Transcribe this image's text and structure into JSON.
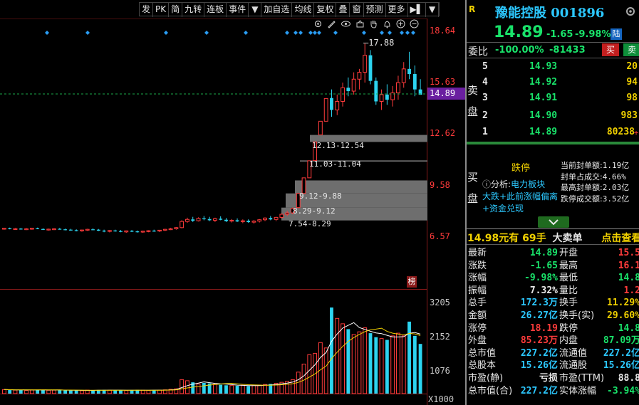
{
  "toolbar": {
    "buttons": [
      "发",
      "PK",
      "简",
      "九转",
      "连板",
      "事件",
      "▼",
      "加自选",
      "均线",
      "复权",
      "叠",
      "窗",
      "预测",
      "更多",
      "▶▌",
      "▼"
    ]
  },
  "chart": {
    "price_axis": [
      "18.64",
      "15.63",
      "14.89",
      "12.62",
      "9.58",
      "6.57"
    ],
    "current_price_tag": "14.89",
    "high_marker": "17.88",
    "gap_labels": [
      "12.13-12.54",
      "11.03-11.04",
      "9.12-9.88",
      "8.29-9.12",
      "7.54-8.29"
    ],
    "volume_axis": [
      "3205",
      "2152",
      "1076",
      "X1000"
    ],
    "rank_badge": "榜",
    "tool_icons": [
      "gear-icon",
      "pen-icon",
      "eye-icon",
      "basket-icon",
      "hand-icon",
      "bell-icon",
      "plus-icon",
      "minus-icon"
    ]
  },
  "chart_data": {
    "type": "candlestick",
    "ylim": [
      5.5,
      19.5
    ],
    "candles": [
      [
        7.05,
        7.1,
        7.0,
        7.08
      ],
      [
        7.08,
        7.12,
        7.02,
        7.05
      ],
      [
        7.05,
        7.1,
        7.0,
        7.06
      ],
      [
        7.06,
        7.1,
        7.0,
        7.03
      ],
      [
        7.03,
        7.09,
        6.98,
        7.05
      ],
      [
        7.05,
        7.1,
        7.0,
        7.08
      ],
      [
        7.08,
        7.12,
        7.03,
        7.04
      ],
      [
        7.04,
        7.08,
        6.98,
        7.0
      ],
      [
        7.0,
        7.06,
        6.95,
        7.03
      ],
      [
        7.03,
        7.08,
        6.98,
        7.05
      ],
      [
        7.05,
        7.1,
        7.0,
        7.02
      ],
      [
        7.02,
        7.06,
        6.96,
        7.0
      ],
      [
        7.0,
        7.05,
        6.94,
        6.97
      ],
      [
        6.97,
        7.02,
        6.9,
        6.95
      ],
      [
        6.95,
        7.0,
        6.88,
        6.98
      ],
      [
        6.98,
        7.05,
        6.93,
        7.02
      ],
      [
        7.02,
        7.08,
        6.97,
        7.0
      ],
      [
        7.0,
        7.04,
        6.92,
        6.94
      ],
      [
        6.94,
        7.0,
        6.85,
        6.9
      ],
      [
        6.9,
        6.98,
        6.84,
        6.95
      ],
      [
        6.95,
        7.0,
        6.88,
        6.92
      ],
      [
        6.92,
        6.98,
        6.85,
        6.87
      ],
      [
        6.87,
        6.95,
        6.82,
        6.93
      ],
      [
        6.93,
        6.98,
        6.86,
        6.9
      ],
      [
        6.9,
        6.95,
        6.83,
        6.88
      ],
      [
        6.88,
        6.94,
        6.82,
        6.91
      ],
      [
        6.91,
        6.97,
        6.85,
        6.94
      ],
      [
        6.94,
        7.0,
        6.88,
        6.92
      ],
      [
        6.92,
        6.98,
        6.86,
        6.97
      ],
      [
        6.97,
        7.05,
        6.92,
        7.02
      ],
      [
        7.02,
        7.1,
        6.98,
        7.05
      ],
      [
        7.05,
        7.15,
        7.0,
        7.12
      ],
      [
        7.12,
        7.55,
        7.08,
        7.48
      ],
      [
        7.48,
        7.7,
        7.4,
        7.6
      ],
      [
        7.6,
        7.75,
        7.45,
        7.52
      ],
      [
        7.52,
        7.72,
        7.48,
        7.66
      ],
      [
        7.66,
        7.8,
        7.55,
        7.62
      ],
      [
        7.62,
        7.75,
        7.5,
        7.55
      ],
      [
        7.55,
        7.7,
        7.45,
        7.64
      ],
      [
        7.64,
        7.78,
        7.55,
        7.58
      ],
      [
        7.58,
        7.68,
        7.45,
        7.5
      ],
      [
        7.5,
        7.62,
        7.42,
        7.55
      ],
      [
        7.55,
        7.66,
        7.45,
        7.48
      ],
      [
        7.48,
        7.6,
        7.38,
        7.52
      ],
      [
        7.52,
        7.6,
        7.4,
        7.44
      ],
      [
        7.44,
        7.56,
        7.35,
        7.5
      ],
      [
        7.5,
        7.62,
        7.42,
        7.58
      ],
      [
        7.58,
        7.72,
        7.5,
        7.68
      ],
      [
        7.68,
        7.8,
        7.55,
        7.6
      ],
      [
        7.6,
        7.75,
        7.5,
        7.72
      ],
      [
        7.72,
        7.95,
        7.65,
        7.9
      ],
      [
        7.9,
        8.1,
        7.8,
        7.98
      ],
      [
        7.98,
        8.3,
        7.9,
        8.25
      ],
      [
        8.29,
        9.12,
        8.29,
        9.12
      ],
      [
        9.12,
        10.03,
        9.12,
        10.03
      ],
      [
        10.03,
        11.03,
        10.03,
        11.03
      ],
      [
        11.04,
        12.13,
        11.04,
        12.13
      ],
      [
        12.54,
        13.34,
        12.54,
        13.34
      ],
      [
        13.34,
        14.67,
        13.34,
        14.67
      ],
      [
        14.7,
        15.2,
        13.6,
        14.0
      ],
      [
        14.0,
        14.9,
        13.7,
        14.5
      ],
      [
        14.5,
        15.6,
        14.2,
        15.3
      ],
      [
        15.3,
        15.9,
        14.8,
        15.1
      ],
      [
        15.1,
        16.2,
        14.9,
        15.8
      ],
      [
        15.8,
        16.4,
        15.2,
        16.2
      ],
      [
        16.2,
        17.88,
        15.6,
        17.2
      ],
      [
        17.2,
        17.5,
        15.5,
        15.7
      ],
      [
        15.7,
        15.9,
        14.3,
        14.5
      ],
      [
        14.5,
        15.2,
        14.0,
        14.9
      ],
      [
        14.9,
        15.5,
        14.3,
        14.6
      ],
      [
        14.6,
        15.4,
        14.2,
        15.0
      ],
      [
        15.0,
        16.0,
        14.6,
        15.6
      ],
      [
        15.6,
        16.8,
        15.3,
        16.4
      ],
      [
        16.4,
        17.4,
        15.8,
        16.1
      ],
      [
        16.1,
        16.6,
        14.8,
        15.2
      ],
      [
        15.2,
        15.8,
        14.89,
        14.89
      ]
    ],
    "volume_x1000": [
      150,
      140,
      130,
      145,
      120,
      135,
      150,
      140,
      125,
      130,
      140,
      120,
      115,
      125,
      110,
      130,
      120,
      135,
      140,
      125,
      130,
      120,
      115,
      135,
      140,
      125,
      120,
      135,
      130,
      140,
      160,
      180,
      520,
      480,
      420,
      360,
      400,
      380,
      350,
      330,
      310,
      300,
      290,
      310,
      280,
      300,
      320,
      340,
      360,
      380,
      420,
      460,
      520,
      800,
      1100,
      1450,
      1500,
      1900,
      1700,
      3205,
      2800,
      2600,
      2400,
      2200,
      2300,
      2450,
      2250,
      2100,
      2050,
      2000,
      2150,
      2250,
      2150,
      2680,
      2150,
      1850
    ]
  },
  "stock": {
    "r_mark": "R",
    "name_code": "豫能控股 001896",
    "price": "14.89",
    "change": "-1.65",
    "change_pct": "-9.98%",
    "lu_badge": "陆",
    "webi_label": "委比",
    "webi_pct": "-100.00%",
    "webi_diff": "-81433",
    "buy_btn": "买",
    "sell_btn": "卖"
  },
  "sell_book": {
    "side_label": "卖盘",
    "levels": [
      {
        "n": "5",
        "price": "14.93",
        "vol": "20"
      },
      {
        "n": "4",
        "price": "14.92",
        "vol": "94"
      },
      {
        "n": "3",
        "price": "14.91",
        "vol": "98"
      },
      {
        "n": "2",
        "price": "14.90",
        "vol": "983"
      },
      {
        "n": "1",
        "price": "14.89",
        "vol": "80238",
        "extra": "+4"
      }
    ]
  },
  "buy_book": {
    "side_label": "买盘",
    "limit_down": "跌停",
    "analysis_prefix": "分析:",
    "analysis_topic": "电力板块",
    "analysis_line2": "大跌+此前涨幅偏离",
    "analysis_line3": "+资金兑现",
    "seal_stats": [
      {
        "label": "当前封单额:",
        "value": "1.19亿"
      },
      {
        "label": "封单占成交:",
        "value": "4.66%"
      },
      {
        "label": "最高封单额:",
        "value": "2.03亿"
      },
      {
        "label": "跌停成交额:",
        "value": "3.52亿"
      }
    ]
  },
  "trade_bar": {
    "price": "14.98元有",
    "lots": "69手",
    "big_sell": "大卖单",
    "click": "点击查看"
  },
  "stats": [
    {
      "l1": "最新",
      "v1": "14.89",
      "c1": "green",
      "l2": "开盘",
      "v2": "15.5",
      "c2": "red"
    },
    {
      "l1": "涨跌",
      "v1": "-1.65",
      "c1": "green",
      "l2": "最高",
      "v2": "16.1",
      "c2": "red"
    },
    {
      "l1": "涨幅",
      "v1": "-9.98%",
      "c1": "green",
      "l2": "最低",
      "v2": "14.8",
      "c2": "green"
    },
    {
      "l1": "振幅",
      "v1": "7.32%",
      "c1": "white",
      "l2": "量比",
      "v2": "1.2",
      "c2": "red"
    },
    {
      "l1": "总手",
      "v1": "172.3万",
      "c1": "cyan",
      "l2": "换手",
      "v2": "11.29%",
      "c2": "yellow"
    },
    {
      "l1": "金额",
      "v1": "26.27亿",
      "c1": "cyan",
      "l2": "换手(实)",
      "v2": "29.60%",
      "c2": "yellow"
    },
    {
      "l1": "涨停",
      "v1": "18.19",
      "c1": "red",
      "l2": "跌停",
      "v2": "14.8",
      "c2": "green"
    },
    {
      "l1": "外盘",
      "v1": "85.23万",
      "c1": "red",
      "l2": "内盘",
      "v2": "87.09万",
      "c2": "green"
    },
    {
      "l1": "总市值",
      "v1": "227.2亿",
      "c1": "cyan",
      "l2": "流通值",
      "v2": "227.2亿",
      "c2": "cyan"
    },
    {
      "l1": "总股本",
      "v1": "15.26亿",
      "c1": "cyan",
      "l2": "流通股",
      "v2": "15.26亿",
      "c2": "cyan"
    },
    {
      "l1": "市盈(静)",
      "v1": "亏损",
      "c1": "white",
      "l2": "市盈(TTM)",
      "v2": "88.8",
      "c2": "white"
    },
    {
      "l1": "总市值(合)",
      "v1": "227.2亿",
      "c1": "cyan",
      "l2": "实体涨幅",
      "v2": "-3.94%",
      "c2": "green"
    }
  ]
}
